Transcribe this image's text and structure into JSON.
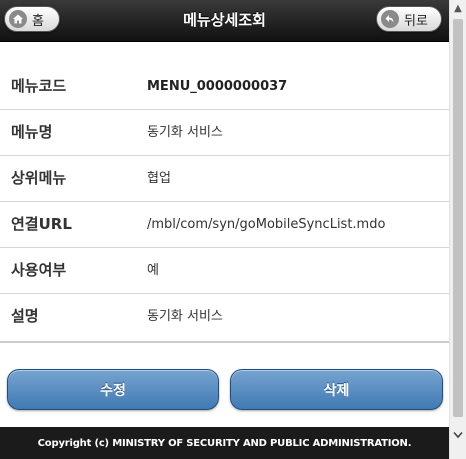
{
  "header": {
    "title": "메뉴상세조회",
    "home_label": "홈",
    "back_label": "뒤로"
  },
  "detail": {
    "rows": [
      {
        "label": "메뉴코드",
        "value": "MENU_0000000037"
      },
      {
        "label": "메뉴명",
        "value": "동기화 서비스"
      },
      {
        "label": "상위메뉴",
        "value": "협업"
      },
      {
        "label": "연결URL",
        "value": "/mbl/com/syn/goMobileSyncList.mdo"
      },
      {
        "label": "사용여부",
        "value": "예"
      },
      {
        "label": "설명",
        "value": "동기화 서비스"
      }
    ]
  },
  "actions": {
    "edit_label": "수정",
    "delete_label": "삭제"
  },
  "footer": {
    "copyright": "Copyright (c) MINISTRY OF SECURITY AND PUBLIC ADMINISTRATION."
  },
  "colors": {
    "header_bg": "#1a1a1a",
    "button_blue": "#4f88c0",
    "footer_bg": "#1b1b1b"
  },
  "icons": {
    "home": "home-icon",
    "back": "back-arrow-icon"
  }
}
